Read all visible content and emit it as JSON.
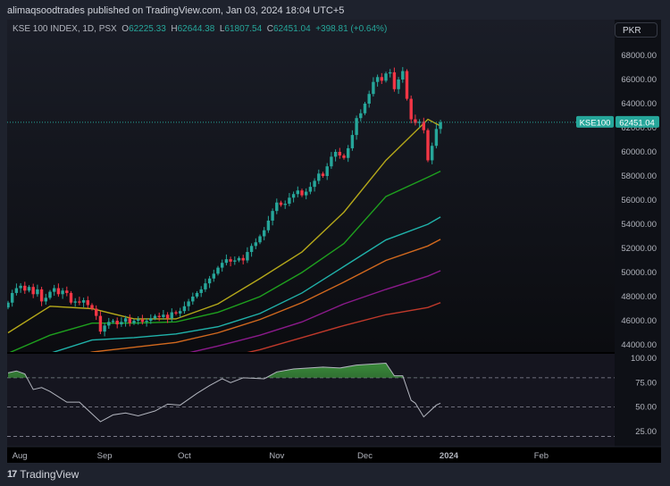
{
  "header": {
    "published": "alimaqsoodtrades published on TradingView.com, Jan 03, 2024 18:04 UTC+5"
  },
  "legend": {
    "symbol": "KSE 100 INDEX, 1D, PSX",
    "o_label": "O",
    "o": "62225.33",
    "h_label": "H",
    "h": "62644.38",
    "l_label": "L",
    "l": "61807.54",
    "c_label": "C",
    "c": "62451.04",
    "change": "+398.81 (+0.64%)"
  },
  "currency": "PKR",
  "last_price": {
    "ticker": "KSE100",
    "value": "62451.04"
  },
  "colors": {
    "up": "#26a69a",
    "down": "#f23645",
    "bg": "#000000",
    "frame": "#1e222d",
    "rsi_line": "#b2b5be",
    "rsi_fill": "#2e7d32"
  },
  "footer": {
    "brand": "TradingView"
  },
  "chart_data": {
    "type": "candlestick",
    "price_axis": {
      "ticks": [
        "68000.00",
        "66000.00",
        "64000.00",
        "62000.00",
        "60000.00",
        "58000.00",
        "56000.00",
        "54000.00",
        "52000.00",
        "50000.00",
        "48000.00",
        "46000.00",
        "44000.00"
      ],
      "range": [
        44000,
        68000
      ]
    },
    "time_axis": {
      "labels": [
        {
          "text": "Aug",
          "idx": 1
        },
        {
          "text": "Sep",
          "idx": 23
        },
        {
          "text": "Oct",
          "idx": 42
        },
        {
          "text": "Nov",
          "idx": 64
        },
        {
          "text": "Dec",
          "idx": 85
        },
        {
          "text": "2024",
          "idx": 105,
          "bold": true
        },
        {
          "text": "Feb",
          "idx": 127
        }
      ]
    },
    "closes": [
      47500,
      48300,
      48700,
      48900,
      48500,
      48800,
      48200,
      48600,
      47600,
      47900,
      48400,
      48700,
      48200,
      48500,
      48300,
      47500,
      47600,
      47500,
      47700,
      47300,
      47000,
      46400,
      45100,
      45600,
      45900,
      46000,
      45700,
      45900,
      46200,
      45800,
      46000,
      46100,
      45900,
      46000,
      46200,
      46400,
      46300,
      46500,
      46200,
      46700,
      46600,
      46800,
      47200,
      47600,
      48000,
      48300,
      48600,
      49100,
      49500,
      49900,
      50400,
      50800,
      51100,
      50900,
      51000,
      51200,
      51000,
      51700,
      52200,
      52500,
      53000,
      53500,
      54300,
      55100,
      55800,
      55600,
      55700,
      56200,
      56500,
      56800,
      56400,
      56700,
      57100,
      57600,
      58200,
      58000,
      58800,
      59600,
      60000,
      59700,
      59500,
      60300,
      61400,
      62800,
      63200,
      64000,
      64800,
      65800,
      66200,
      65900,
      66500,
      66600,
      65200,
      66000,
      66700,
      64400,
      62700,
      62400,
      62500,
      61800,
      59300,
      60500,
      61900,
      62451
    ],
    "first_open": 47100,
    "moving_averages": {
      "idx": [
        0,
        10,
        20,
        30,
        40,
        50,
        60,
        70,
        80,
        90,
        100,
        103
      ],
      "series": [
        {
          "name": "MA1",
          "color": "#b5a81a",
          "values": [
            45000,
            47200,
            47000,
            46150,
            46150,
            47400,
            49500,
            51700,
            55000,
            59300,
            62700,
            62150
          ]
        },
        {
          "name": "MA2",
          "color": "#1ea01e",
          "values": [
            43300,
            44800,
            45800,
            45800,
            45900,
            46700,
            48000,
            50000,
            52400,
            56300,
            57900,
            58400
          ]
        },
        {
          "name": "MA3",
          "color": "#20b2aa",
          "values": [
            42200,
            43300,
            44400,
            44600,
            44900,
            45500,
            46600,
            48300,
            50500,
            52700,
            54000,
            54600
          ]
        },
        {
          "name": "MA4",
          "color": "#d2691e",
          "values": [
            41500,
            42500,
            43400,
            43800,
            44200,
            45000,
            46100,
            47500,
            49200,
            51000,
            52200,
            52750
          ]
        },
        {
          "name": "MA5",
          "color": "#8b1a8b",
          "values": [
            40500,
            41300,
            42000,
            42600,
            43100,
            43900,
            44800,
            45900,
            47400,
            48600,
            49700,
            50150
          ]
        },
        {
          "name": "MA6",
          "color": "#c0392b",
          "values": [
            39500,
            40200,
            40900,
            41500,
            42100,
            42800,
            43600,
            44600,
            45600,
            46500,
            47100,
            47500
          ]
        }
      ]
    },
    "rsi": {
      "ticks": [
        "100.00",
        "75.00",
        "50.00",
        "25.00"
      ],
      "bands": [
        80,
        50,
        20
      ],
      "points": [
        [
          0,
          85
        ],
        [
          2,
          87
        ],
        [
          4,
          84
        ],
        [
          6,
          68
        ],
        [
          8,
          70
        ],
        [
          10,
          66
        ],
        [
          14,
          55
        ],
        [
          17,
          55
        ],
        [
          20,
          43
        ],
        [
          22,
          35
        ],
        [
          25,
          42
        ],
        [
          28,
          44
        ],
        [
          31,
          41
        ],
        [
          35,
          46
        ],
        [
          38,
          53
        ],
        [
          41,
          52
        ],
        [
          45,
          64
        ],
        [
          48,
          72
        ],
        [
          51,
          79
        ],
        [
          53,
          75
        ],
        [
          56,
          80
        ],
        [
          61,
          79
        ],
        [
          64,
          86
        ],
        [
          68,
          89
        ],
        [
          75,
          91
        ],
        [
          79,
          90
        ],
        [
          83,
          93
        ],
        [
          90,
          95
        ],
        [
          92,
          82
        ],
        [
          94,
          82
        ],
        [
          96,
          57
        ],
        [
          97,
          54
        ],
        [
          99,
          40
        ],
        [
          102,
          52
        ],
        [
          103,
          54
        ]
      ]
    }
  }
}
